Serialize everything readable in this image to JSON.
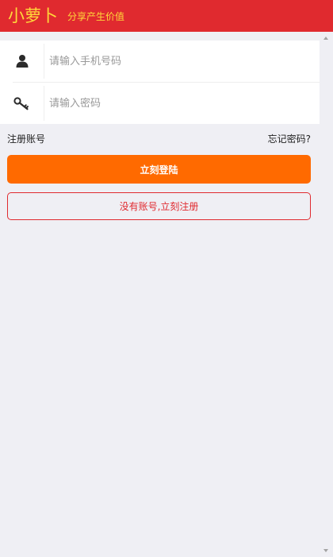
{
  "header": {
    "brand_name": "小萝卜",
    "slogan": "分享产生价值"
  },
  "form": {
    "phone_placeholder": "请输入手机号码",
    "password_placeholder": "请输入密码",
    "phone_icon": "user-icon",
    "password_icon": "key-icon"
  },
  "links": {
    "register_account": "注册账号",
    "forgot_password": "忘记密码?"
  },
  "buttons": {
    "login": "立刻登陆",
    "register": "没有账号,立刻注册"
  },
  "colors": {
    "header_bg": "#e02a2f",
    "brand_text": "#ffd83a",
    "login_bg": "#ff6a00",
    "register_border": "#e02a2f",
    "page_bg": "#efeff4"
  }
}
